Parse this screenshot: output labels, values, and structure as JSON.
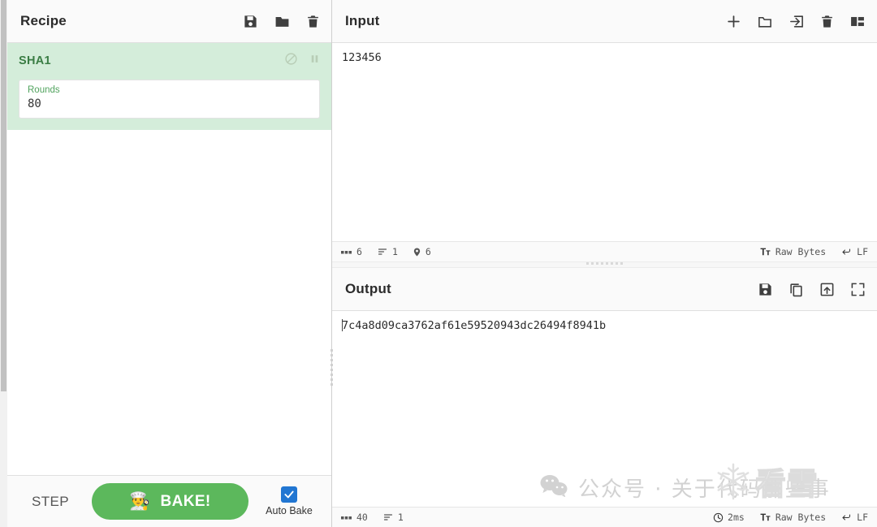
{
  "recipe": {
    "title": "Recipe",
    "icons": [
      {
        "name": "save-recipe-icon",
        "glyph": "save"
      },
      {
        "name": "load-recipe-icon",
        "glyph": "folder"
      },
      {
        "name": "clear-recipe-icon",
        "glyph": "trash"
      }
    ],
    "operations": [
      {
        "name": "SHA1",
        "disable_icon": "disable-icon",
        "breakpoint_icon": "pause-icon",
        "args": [
          {
            "label": "Rounds",
            "value": "80"
          }
        ]
      }
    ]
  },
  "controls": {
    "step_label": "STEP",
    "bake_label": "BAKE!",
    "bake_emoji": "👨‍🍳",
    "auto_bake_label": "Auto Bake",
    "auto_bake_checked": true,
    "bake_color": "#5cb85c",
    "checkbox_color": "#2176d2"
  },
  "input": {
    "title": "Input",
    "value": "123456",
    "icons": [
      {
        "name": "add-input-tab-icon",
        "glyph": "plus"
      },
      {
        "name": "open-folder-as-input-icon",
        "glyph": "folder-open"
      },
      {
        "name": "open-file-as-input-icon",
        "glyph": "arrow-into-box"
      },
      {
        "name": "clear-input-icon",
        "glyph": "trash"
      },
      {
        "name": "reset-pane-layout-icon",
        "glyph": "layout"
      }
    ],
    "status": {
      "length_icon": "abc-icon",
      "length": "6",
      "lines_icon": "lines-icon",
      "lines": "1",
      "position_icon": "map-pin-icon",
      "position": "6",
      "encoding_icon": "font-icon",
      "encoding": "Raw Bytes",
      "line_ending_icon": "enter-arrow-icon",
      "line_ending": "LF"
    }
  },
  "output": {
    "title": "Output",
    "value": "7c4a8d09ca3762af61e59520943dc26494f8941b",
    "icons": [
      {
        "name": "save-output-icon",
        "glyph": "save"
      },
      {
        "name": "copy-output-icon",
        "glyph": "copy"
      },
      {
        "name": "replace-input-with-output-icon",
        "glyph": "box-up-arrow"
      },
      {
        "name": "maximise-output-icon",
        "glyph": "maximise"
      }
    ],
    "status": {
      "length_icon": "abc-icon",
      "length": "40",
      "lines_icon": "lines-icon",
      "lines": "1",
      "time_icon": "clock-icon",
      "time": "2ms",
      "encoding_icon": "font-icon",
      "encoding": "Raw Bytes",
      "line_ending_icon": "enter-arrow-icon",
      "line_ending": "LF"
    }
  },
  "watermarks": {
    "wechat_icon": "wechat-icon",
    "wechat_text": "公众号 · 关于代码那些事",
    "kanxue_icon": "snowflake-icon",
    "kanxue_text": "看雪"
  }
}
